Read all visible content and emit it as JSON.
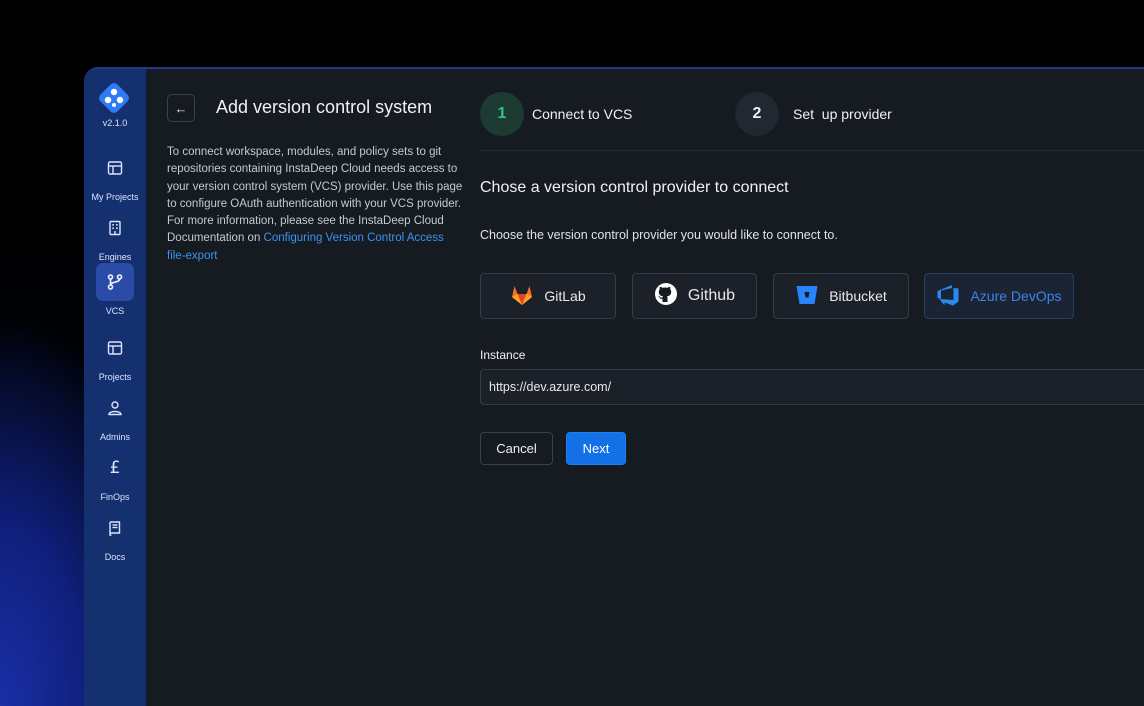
{
  "app": {
    "version": "v2.1.0"
  },
  "sidebar": {
    "items": [
      {
        "label": "My Projects",
        "icon": "layout-icon"
      },
      {
        "label": "Engines",
        "icon": "building-icon"
      },
      {
        "label": "VCS",
        "icon": "git-branch-icon",
        "active": true
      },
      {
        "label": "Projects",
        "icon": "layout-icon"
      },
      {
        "label": "Admins",
        "icon": "admin-user-icon"
      },
      {
        "label": "FinOps",
        "icon": "pound-icon"
      },
      {
        "label": "Docs",
        "icon": "book-icon"
      }
    ]
  },
  "page": {
    "title": "Add version control system",
    "intro_text": "To connect workspace, modules, and policy sets to git repositories containing InstaDeep Cloud needs access to your version control system (VCS) provider. Use this page to configure OAuth authentication with your VCS provider. For more information, please see the InstaDeep Cloud Documentation on ",
    "intro_link": "Configuring Version Control Access",
    "intro_link_icon": "file-export"
  },
  "stepper": {
    "steps": [
      {
        "number": "1",
        "label": "Connect to VCS",
        "state": "active"
      },
      {
        "number": "2",
        "label": "Set  up provider",
        "state": "pending"
      }
    ]
  },
  "form": {
    "section_title": "Chose a version control provider to connect",
    "section_desc": "Choose the version control provider you would like to connect to.",
    "providers": [
      {
        "label": "GitLab",
        "icon": "gitlab-icon"
      },
      {
        "label": "Github",
        "icon": "github-icon"
      },
      {
        "label": "Bitbucket",
        "icon": "bitbucket-icon"
      },
      {
        "label": "Azure DevOps",
        "icon": "azure-devops-icon",
        "selected": true
      }
    ],
    "instance_label": "Instance",
    "instance_value": "https://dev.azure.com/",
    "cancel_label": "Cancel",
    "next_label": "Next"
  },
  "colors": {
    "accent": "#1370e6",
    "sidebar": "#15306f",
    "step_active": "#1f3a34",
    "step_active_text": "#36c08a"
  }
}
